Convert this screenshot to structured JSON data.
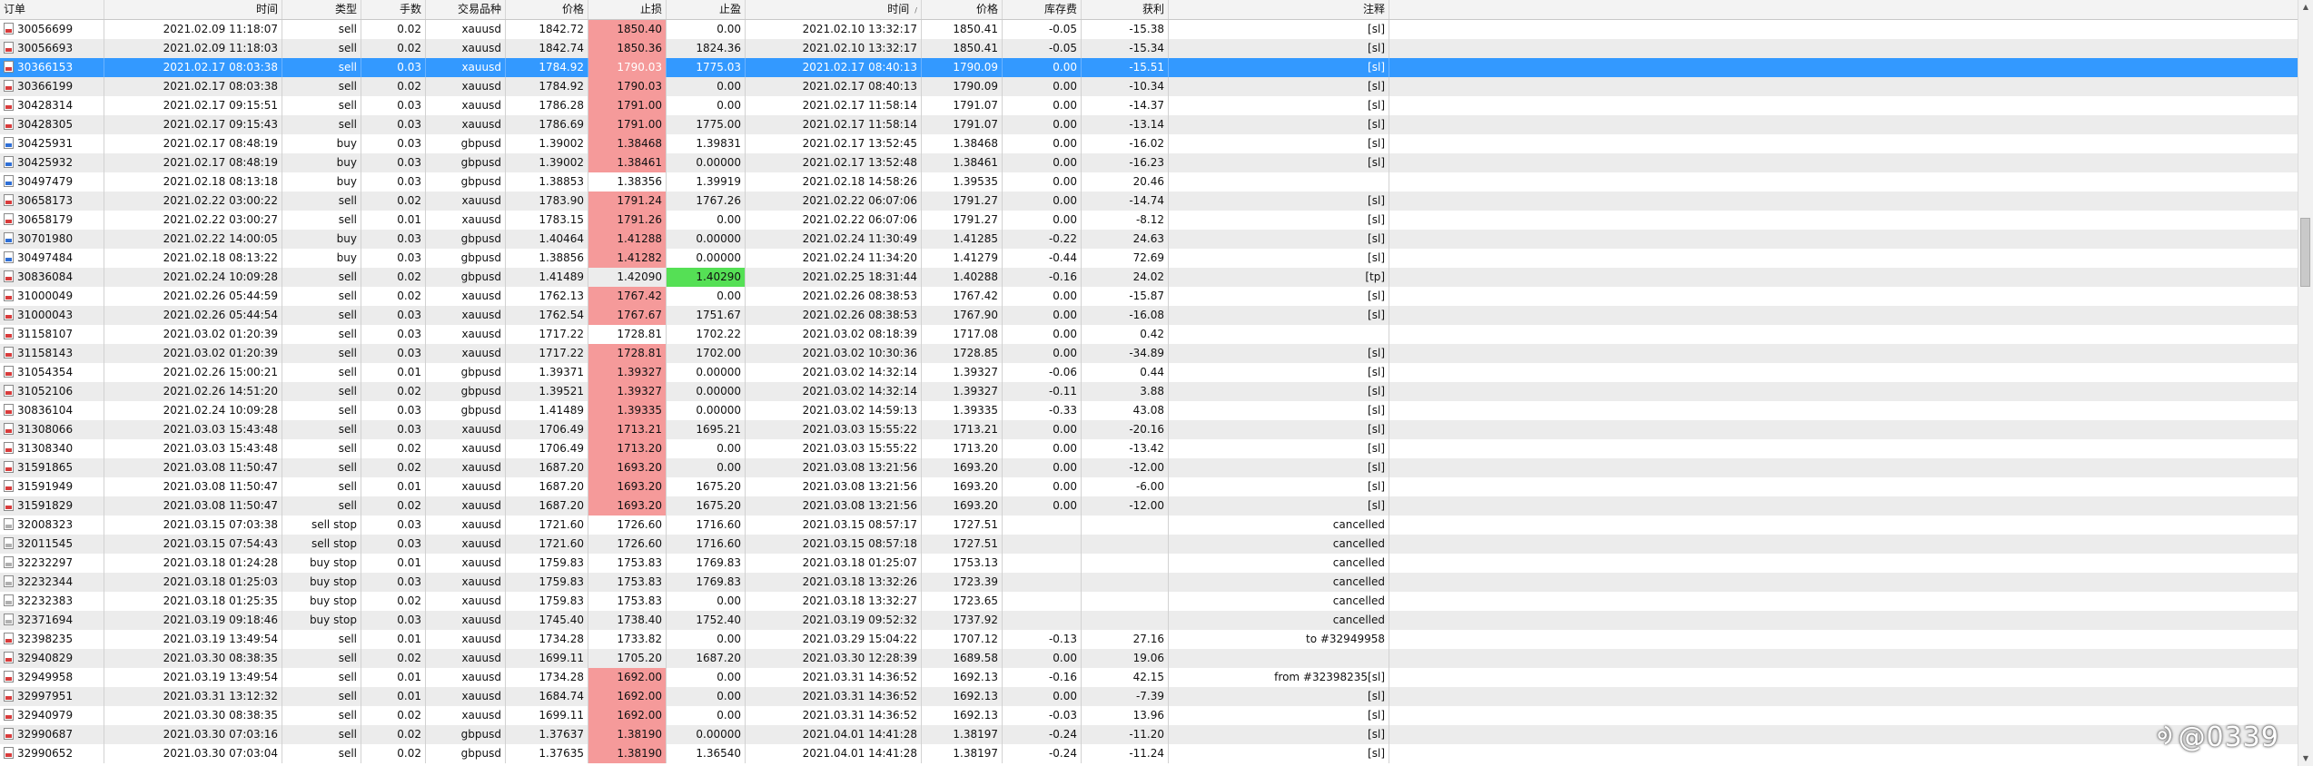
{
  "columns": [
    {
      "key": "order",
      "label": "订单"
    },
    {
      "key": "open_time",
      "label": "时间"
    },
    {
      "key": "type",
      "label": "类型"
    },
    {
      "key": "lots",
      "label": "手数"
    },
    {
      "key": "symbol",
      "label": "交易品种"
    },
    {
      "key": "open_price",
      "label": "价格"
    },
    {
      "key": "sl",
      "label": "止损"
    },
    {
      "key": "tp",
      "label": "止盈"
    },
    {
      "key": "close_time",
      "label": "时间"
    },
    {
      "key": "close_price",
      "label": "价格"
    },
    {
      "key": "swap",
      "label": "库存费"
    },
    {
      "key": "profit",
      "label": "获利"
    },
    {
      "key": "comment",
      "label": "注释"
    }
  ],
  "sort_indicator": "/",
  "rows": [
    {
      "order": "30056699",
      "open_time": "2021.02.09 11:18:07",
      "type": "sell",
      "lots": "0.02",
      "symbol": "xauusd",
      "open_price": "1842.72",
      "sl": "1850.40",
      "tp": "0.00",
      "close_time": "2021.02.10 13:32:17",
      "close_price": "1850.41",
      "swap": "-0.05",
      "profit": "-15.38",
      "comment": "[sl]",
      "sl_hl": "red",
      "tp_hl": "",
      "selected": false,
      "icon": "sellc"
    },
    {
      "order": "30056693",
      "open_time": "2021.02.09 11:18:03",
      "type": "sell",
      "lots": "0.02",
      "symbol": "xauusd",
      "open_price": "1842.74",
      "sl": "1850.36",
      "tp": "1824.36",
      "close_time": "2021.02.10 13:32:17",
      "close_price": "1850.41",
      "swap": "-0.05",
      "profit": "-15.34",
      "comment": "[sl]",
      "sl_hl": "red",
      "tp_hl": "",
      "selected": false,
      "icon": "sellc"
    },
    {
      "order": "30366153",
      "open_time": "2021.02.17 08:03:38",
      "type": "sell",
      "lots": "0.03",
      "symbol": "xauusd",
      "open_price": "1784.92",
      "sl": "1790.03",
      "tp": "1775.03",
      "close_time": "2021.02.17 08:40:13",
      "close_price": "1790.09",
      "swap": "0.00",
      "profit": "-15.51",
      "comment": "[sl]",
      "sl_hl": "red",
      "tp_hl": "",
      "selected": true,
      "icon": "sellc"
    },
    {
      "order": "30366199",
      "open_time": "2021.02.17 08:03:38",
      "type": "sell",
      "lots": "0.02",
      "symbol": "xauusd",
      "open_price": "1784.92",
      "sl": "1790.03",
      "tp": "0.00",
      "close_time": "2021.02.17 08:40:13",
      "close_price": "1790.09",
      "swap": "0.00",
      "profit": "-10.34",
      "comment": "[sl]",
      "sl_hl": "red",
      "tp_hl": "",
      "selected": false,
      "icon": "sellc"
    },
    {
      "order": "30428314",
      "open_time": "2021.02.17 09:15:51",
      "type": "sell",
      "lots": "0.03",
      "symbol": "xauusd",
      "open_price": "1786.28",
      "sl": "1791.00",
      "tp": "0.00",
      "close_time": "2021.02.17 11:58:14",
      "close_price": "1791.07",
      "swap": "0.00",
      "profit": "-14.37",
      "comment": "[sl]",
      "sl_hl": "red",
      "tp_hl": "",
      "selected": false,
      "icon": "sellc"
    },
    {
      "order": "30428305",
      "open_time": "2021.02.17 09:15:43",
      "type": "sell",
      "lots": "0.03",
      "symbol": "xauusd",
      "open_price": "1786.69",
      "sl": "1791.00",
      "tp": "1775.00",
      "close_time": "2021.02.17 11:58:14",
      "close_price": "1791.07",
      "swap": "0.00",
      "profit": "-13.14",
      "comment": "[sl]",
      "sl_hl": "red",
      "tp_hl": "",
      "selected": false,
      "icon": "sellc"
    },
    {
      "order": "30425931",
      "open_time": "2021.02.17 08:48:19",
      "type": "buy",
      "lots": "0.03",
      "symbol": "gbpusd",
      "open_price": "1.39002",
      "sl": "1.38468",
      "tp": "1.39831",
      "close_time": "2021.02.17 13:52:45",
      "close_price": "1.38468",
      "swap": "0.00",
      "profit": "-16.02",
      "comment": "[sl]",
      "sl_hl": "red",
      "tp_hl": "",
      "selected": false,
      "icon": "buyc"
    },
    {
      "order": "30425932",
      "open_time": "2021.02.17 08:48:19",
      "type": "buy",
      "lots": "0.03",
      "symbol": "gbpusd",
      "open_price": "1.39002",
      "sl": "1.38461",
      "tp": "0.00000",
      "close_time": "2021.02.17 13:52:48",
      "close_price": "1.38461",
      "swap": "0.00",
      "profit": "-16.23",
      "comment": "[sl]",
      "sl_hl": "red",
      "tp_hl": "",
      "selected": false,
      "icon": "buyc"
    },
    {
      "order": "30497479",
      "open_time": "2021.02.18 08:13:18",
      "type": "buy",
      "lots": "0.03",
      "symbol": "gbpusd",
      "open_price": "1.38853",
      "sl": "1.38356",
      "tp": "1.39919",
      "close_time": "2021.02.18 14:58:26",
      "close_price": "1.39535",
      "swap": "0.00",
      "profit": "20.46",
      "comment": "",
      "sl_hl": "",
      "tp_hl": "",
      "selected": false,
      "icon": "buyc"
    },
    {
      "order": "30658173",
      "open_time": "2021.02.22 03:00:22",
      "type": "sell",
      "lots": "0.02",
      "symbol": "xauusd",
      "open_price": "1783.90",
      "sl": "1791.24",
      "tp": "1767.26",
      "close_time": "2021.02.22 06:07:06",
      "close_price": "1791.27",
      "swap": "0.00",
      "profit": "-14.74",
      "comment": "[sl]",
      "sl_hl": "red",
      "tp_hl": "",
      "selected": false,
      "icon": "sellc"
    },
    {
      "order": "30658179",
      "open_time": "2021.02.22 03:00:27",
      "type": "sell",
      "lots": "0.01",
      "symbol": "xauusd",
      "open_price": "1783.15",
      "sl": "1791.26",
      "tp": "0.00",
      "close_time": "2021.02.22 06:07:06",
      "close_price": "1791.27",
      "swap": "0.00",
      "profit": "-8.12",
      "comment": "[sl]",
      "sl_hl": "red",
      "tp_hl": "",
      "selected": false,
      "icon": "sellc"
    },
    {
      "order": "30701980",
      "open_time": "2021.02.22 14:00:05",
      "type": "buy",
      "lots": "0.03",
      "symbol": "gbpusd",
      "open_price": "1.40464",
      "sl": "1.41288",
      "tp": "0.00000",
      "close_time": "2021.02.24 11:30:49",
      "close_price": "1.41285",
      "swap": "-0.22",
      "profit": "24.63",
      "comment": "[sl]",
      "sl_hl": "red",
      "tp_hl": "",
      "selected": false,
      "icon": "buyc"
    },
    {
      "order": "30497484",
      "open_time": "2021.02.18 08:13:22",
      "type": "buy",
      "lots": "0.03",
      "symbol": "gbpusd",
      "open_price": "1.38856",
      "sl": "1.41282",
      "tp": "0.00000",
      "close_time": "2021.02.24 11:34:20",
      "close_price": "1.41279",
      "swap": "-0.44",
      "profit": "72.69",
      "comment": "[sl]",
      "sl_hl": "red",
      "tp_hl": "",
      "selected": false,
      "icon": "buyc"
    },
    {
      "order": "30836084",
      "open_time": "2021.02.24 10:09:28",
      "type": "sell",
      "lots": "0.02",
      "symbol": "gbpusd",
      "open_price": "1.41489",
      "sl": "1.42090",
      "tp": "1.40290",
      "close_time": "2021.02.25 18:31:44",
      "close_price": "1.40288",
      "swap": "-0.16",
      "profit": "24.02",
      "comment": "[tp]",
      "sl_hl": "",
      "tp_hl": "green",
      "selected": false,
      "icon": "sellc"
    },
    {
      "order": "31000049",
      "open_time": "2021.02.26 05:44:59",
      "type": "sell",
      "lots": "0.02",
      "symbol": "xauusd",
      "open_price": "1762.13",
      "sl": "1767.42",
      "tp": "0.00",
      "close_time": "2021.02.26 08:38:53",
      "close_price": "1767.42",
      "swap": "0.00",
      "profit": "-15.87",
      "comment": "[sl]",
      "sl_hl": "red",
      "tp_hl": "",
      "selected": false,
      "icon": "sellc"
    },
    {
      "order": "31000043",
      "open_time": "2021.02.26 05:44:54",
      "type": "sell",
      "lots": "0.03",
      "symbol": "xauusd",
      "open_price": "1762.54",
      "sl": "1767.67",
      "tp": "1751.67",
      "close_time": "2021.02.26 08:38:53",
      "close_price": "1767.90",
      "swap": "0.00",
      "profit": "-16.08",
      "comment": "[sl]",
      "sl_hl": "red",
      "tp_hl": "",
      "selected": false,
      "icon": "sellc"
    },
    {
      "order": "31158107",
      "open_time": "2021.03.02 01:20:39",
      "type": "sell",
      "lots": "0.03",
      "symbol": "xauusd",
      "open_price": "1717.22",
      "sl": "1728.81",
      "tp": "1702.22",
      "close_time": "2021.03.02 08:18:39",
      "close_price": "1717.08",
      "swap": "0.00",
      "profit": "0.42",
      "comment": "",
      "sl_hl": "",
      "tp_hl": "",
      "selected": false,
      "icon": "sellc"
    },
    {
      "order": "31158143",
      "open_time": "2021.03.02 01:20:39",
      "type": "sell",
      "lots": "0.03",
      "symbol": "xauusd",
      "open_price": "1717.22",
      "sl": "1728.81",
      "tp": "1702.00",
      "close_time": "2021.03.02 10:30:36",
      "close_price": "1728.85",
      "swap": "0.00",
      "profit": "-34.89",
      "comment": "[sl]",
      "sl_hl": "red",
      "tp_hl": "",
      "selected": false,
      "icon": "sellc"
    },
    {
      "order": "31054354",
      "open_time": "2021.02.26 15:00:21",
      "type": "sell",
      "lots": "0.01",
      "symbol": "gbpusd",
      "open_price": "1.39371",
      "sl": "1.39327",
      "tp": "0.00000",
      "close_time": "2021.03.02 14:32:14",
      "close_price": "1.39327",
      "swap": "-0.06",
      "profit": "0.44",
      "comment": "[sl]",
      "sl_hl": "red",
      "tp_hl": "",
      "selected": false,
      "icon": "sellc"
    },
    {
      "order": "31052106",
      "open_time": "2021.02.26 14:51:20",
      "type": "sell",
      "lots": "0.02",
      "symbol": "gbpusd",
      "open_price": "1.39521",
      "sl": "1.39327",
      "tp": "0.00000",
      "close_time": "2021.03.02 14:32:14",
      "close_price": "1.39327",
      "swap": "-0.11",
      "profit": "3.88",
      "comment": "[sl]",
      "sl_hl": "red",
      "tp_hl": "",
      "selected": false,
      "icon": "sellc"
    },
    {
      "order": "30836104",
      "open_time": "2021.02.24 10:09:28",
      "type": "sell",
      "lots": "0.03",
      "symbol": "gbpusd",
      "open_price": "1.41489",
      "sl": "1.39335",
      "tp": "0.00000",
      "close_time": "2021.03.02 14:59:13",
      "close_price": "1.39335",
      "swap": "-0.33",
      "profit": "43.08",
      "comment": "[sl]",
      "sl_hl": "red",
      "tp_hl": "",
      "selected": false,
      "icon": "sellc"
    },
    {
      "order": "31308066",
      "open_time": "2021.03.03 15:43:48",
      "type": "sell",
      "lots": "0.03",
      "symbol": "xauusd",
      "open_price": "1706.49",
      "sl": "1713.21",
      "tp": "1695.21",
      "close_time": "2021.03.03 15:55:22",
      "close_price": "1713.21",
      "swap": "0.00",
      "profit": "-20.16",
      "comment": "[sl]",
      "sl_hl": "red",
      "tp_hl": "",
      "selected": false,
      "icon": "sellc"
    },
    {
      "order": "31308340",
      "open_time": "2021.03.03 15:43:48",
      "type": "sell",
      "lots": "0.02",
      "symbol": "xauusd",
      "open_price": "1706.49",
      "sl": "1713.20",
      "tp": "0.00",
      "close_time": "2021.03.03 15:55:22",
      "close_price": "1713.20",
      "swap": "0.00",
      "profit": "-13.42",
      "comment": "[sl]",
      "sl_hl": "red",
      "tp_hl": "",
      "selected": false,
      "icon": "sellc"
    },
    {
      "order": "31591865",
      "open_time": "2021.03.08 11:50:47",
      "type": "sell",
      "lots": "0.02",
      "symbol": "xauusd",
      "open_price": "1687.20",
      "sl": "1693.20",
      "tp": "0.00",
      "close_time": "2021.03.08 13:21:56",
      "close_price": "1693.20",
      "swap": "0.00",
      "profit": "-12.00",
      "comment": "[sl]",
      "sl_hl": "red",
      "tp_hl": "",
      "selected": false,
      "icon": "sellc"
    },
    {
      "order": "31591949",
      "open_time": "2021.03.08 11:50:47",
      "type": "sell",
      "lots": "0.01",
      "symbol": "xauusd",
      "open_price": "1687.20",
      "sl": "1693.20",
      "tp": "1675.20",
      "close_time": "2021.03.08 13:21:56",
      "close_price": "1693.20",
      "swap": "0.00",
      "profit": "-6.00",
      "comment": "[sl]",
      "sl_hl": "red",
      "tp_hl": "",
      "selected": false,
      "icon": "sellc"
    },
    {
      "order": "31591829",
      "open_time": "2021.03.08 11:50:47",
      "type": "sell",
      "lots": "0.02",
      "symbol": "xauusd",
      "open_price": "1687.20",
      "sl": "1693.20",
      "tp": "1675.20",
      "close_time": "2021.03.08 13:21:56",
      "close_price": "1693.20",
      "swap": "0.00",
      "profit": "-12.00",
      "comment": "[sl]",
      "sl_hl": "red",
      "tp_hl": "",
      "selected": false,
      "icon": "sellc"
    },
    {
      "order": "32008323",
      "open_time": "2021.03.15 07:03:38",
      "type": "sell stop",
      "lots": "0.03",
      "symbol": "xauusd",
      "open_price": "1721.60",
      "sl": "1726.60",
      "tp": "1716.60",
      "close_time": "2021.03.15 08:57:17",
      "close_price": "1727.51",
      "swap": "",
      "profit": "",
      "comment": "cancelled",
      "sl_hl": "",
      "tp_hl": "",
      "selected": false,
      "icon": "pend"
    },
    {
      "order": "32011545",
      "open_time": "2021.03.15 07:54:43",
      "type": "sell stop",
      "lots": "0.03",
      "symbol": "xauusd",
      "open_price": "1721.60",
      "sl": "1726.60",
      "tp": "1716.60",
      "close_time": "2021.03.15 08:57:18",
      "close_price": "1727.51",
      "swap": "",
      "profit": "",
      "comment": "cancelled",
      "sl_hl": "",
      "tp_hl": "",
      "selected": false,
      "icon": "pend"
    },
    {
      "order": "32232297",
      "open_time": "2021.03.18 01:24:28",
      "type": "buy stop",
      "lots": "0.01",
      "symbol": "xauusd",
      "open_price": "1759.83",
      "sl": "1753.83",
      "tp": "1769.83",
      "close_time": "2021.03.18 01:25:07",
      "close_price": "1753.13",
      "swap": "",
      "profit": "",
      "comment": "cancelled",
      "sl_hl": "",
      "tp_hl": "",
      "selected": false,
      "icon": "pend"
    },
    {
      "order": "32232344",
      "open_time": "2021.03.18 01:25:03",
      "type": "buy stop",
      "lots": "0.03",
      "symbol": "xauusd",
      "open_price": "1759.83",
      "sl": "1753.83",
      "tp": "1769.83",
      "close_time": "2021.03.18 13:32:26",
      "close_price": "1723.39",
      "swap": "",
      "profit": "",
      "comment": "cancelled",
      "sl_hl": "",
      "tp_hl": "",
      "selected": false,
      "icon": "pend"
    },
    {
      "order": "32232383",
      "open_time": "2021.03.18 01:25:35",
      "type": "buy stop",
      "lots": "0.02",
      "symbol": "xauusd",
      "open_price": "1759.83",
      "sl": "1753.83",
      "tp": "0.00",
      "close_time": "2021.03.18 13:32:27",
      "close_price": "1723.65",
      "swap": "",
      "profit": "",
      "comment": "cancelled",
      "sl_hl": "",
      "tp_hl": "",
      "selected": false,
      "icon": "pend"
    },
    {
      "order": "32371694",
      "open_time": "2021.03.19 09:18:46",
      "type": "buy stop",
      "lots": "0.03",
      "symbol": "xauusd",
      "open_price": "1745.40",
      "sl": "1738.40",
      "tp": "1752.40",
      "close_time": "2021.03.19 09:52:32",
      "close_price": "1737.92",
      "swap": "",
      "profit": "",
      "comment": "cancelled",
      "sl_hl": "",
      "tp_hl": "",
      "selected": false,
      "icon": "pend"
    },
    {
      "order": "32398235",
      "open_time": "2021.03.19 13:49:54",
      "type": "sell",
      "lots": "0.01",
      "symbol": "xauusd",
      "open_price": "1734.28",
      "sl": "1733.82",
      "tp": "0.00",
      "close_time": "2021.03.29 15:04:22",
      "close_price": "1707.12",
      "swap": "-0.13",
      "profit": "27.16",
      "comment": "to #32949958",
      "sl_hl": "",
      "tp_hl": "",
      "selected": false,
      "icon": "sellc"
    },
    {
      "order": "32940829",
      "open_time": "2021.03.30 08:38:35",
      "type": "sell",
      "lots": "0.02",
      "symbol": "xauusd",
      "open_price": "1699.11",
      "sl": "1705.20",
      "tp": "1687.20",
      "close_time": "2021.03.30 12:28:39",
      "close_price": "1689.58",
      "swap": "0.00",
      "profit": "19.06",
      "comment": "",
      "sl_hl": "",
      "tp_hl": "",
      "selected": false,
      "icon": "sellc"
    },
    {
      "order": "32949958",
      "open_time": "2021.03.19 13:49:54",
      "type": "sell",
      "lots": "0.01",
      "symbol": "xauusd",
      "open_price": "1734.28",
      "sl": "1692.00",
      "tp": "0.00",
      "close_time": "2021.03.31 14:36:52",
      "close_price": "1692.13",
      "swap": "-0.16",
      "profit": "42.15",
      "comment": "from #32398235[sl]",
      "sl_hl": "red",
      "tp_hl": "",
      "selected": false,
      "icon": "sellc"
    },
    {
      "order": "32997951",
      "open_time": "2021.03.31 13:12:32",
      "type": "sell",
      "lots": "0.01",
      "symbol": "xauusd",
      "open_price": "1684.74",
      "sl": "1692.00",
      "tp": "0.00",
      "close_time": "2021.03.31 14:36:52",
      "close_price": "1692.13",
      "swap": "0.00",
      "profit": "-7.39",
      "comment": "[sl]",
      "sl_hl": "red",
      "tp_hl": "",
      "selected": false,
      "icon": "sellc"
    },
    {
      "order": "32940979",
      "open_time": "2021.03.30 08:38:35",
      "type": "sell",
      "lots": "0.02",
      "symbol": "xauusd",
      "open_price": "1699.11",
      "sl": "1692.00",
      "tp": "0.00",
      "close_time": "2021.03.31 14:36:52",
      "close_price": "1692.13",
      "swap": "-0.03",
      "profit": "13.96",
      "comment": "[sl]",
      "sl_hl": "red",
      "tp_hl": "",
      "selected": false,
      "icon": "sellc"
    },
    {
      "order": "32990687",
      "open_time": "2021.03.30 07:03:16",
      "type": "sell",
      "lots": "0.02",
      "symbol": "gbpusd",
      "open_price": "1.37637",
      "sl": "1.38190",
      "tp": "0.00000",
      "close_time": "2021.04.01 14:41:28",
      "close_price": "1.38197",
      "swap": "-0.24",
      "profit": "-11.20",
      "comment": "[sl]",
      "sl_hl": "red",
      "tp_hl": "",
      "selected": false,
      "icon": "sellc"
    },
    {
      "order": "32990652",
      "open_time": "2021.03.30 07:03:04",
      "type": "sell",
      "lots": "0.02",
      "symbol": "gbpusd",
      "open_price": "1.37635",
      "sl": "1.38190",
      "tp": "1.36540",
      "close_time": "2021.04.01 14:41:28",
      "close_price": "1.38197",
      "swap": "-0.24",
      "profit": "-11.24",
      "comment": "[sl]",
      "sl_hl": "red",
      "tp_hl": "",
      "selected": false,
      "icon": "sellc"
    }
  ],
  "watermark": {
    "text": "@0339"
  },
  "colors": {
    "selected": "#3399ff",
    "sl_hit": "#f59a9a",
    "tp_hit": "#55e055",
    "row_alt": "#ececec"
  }
}
